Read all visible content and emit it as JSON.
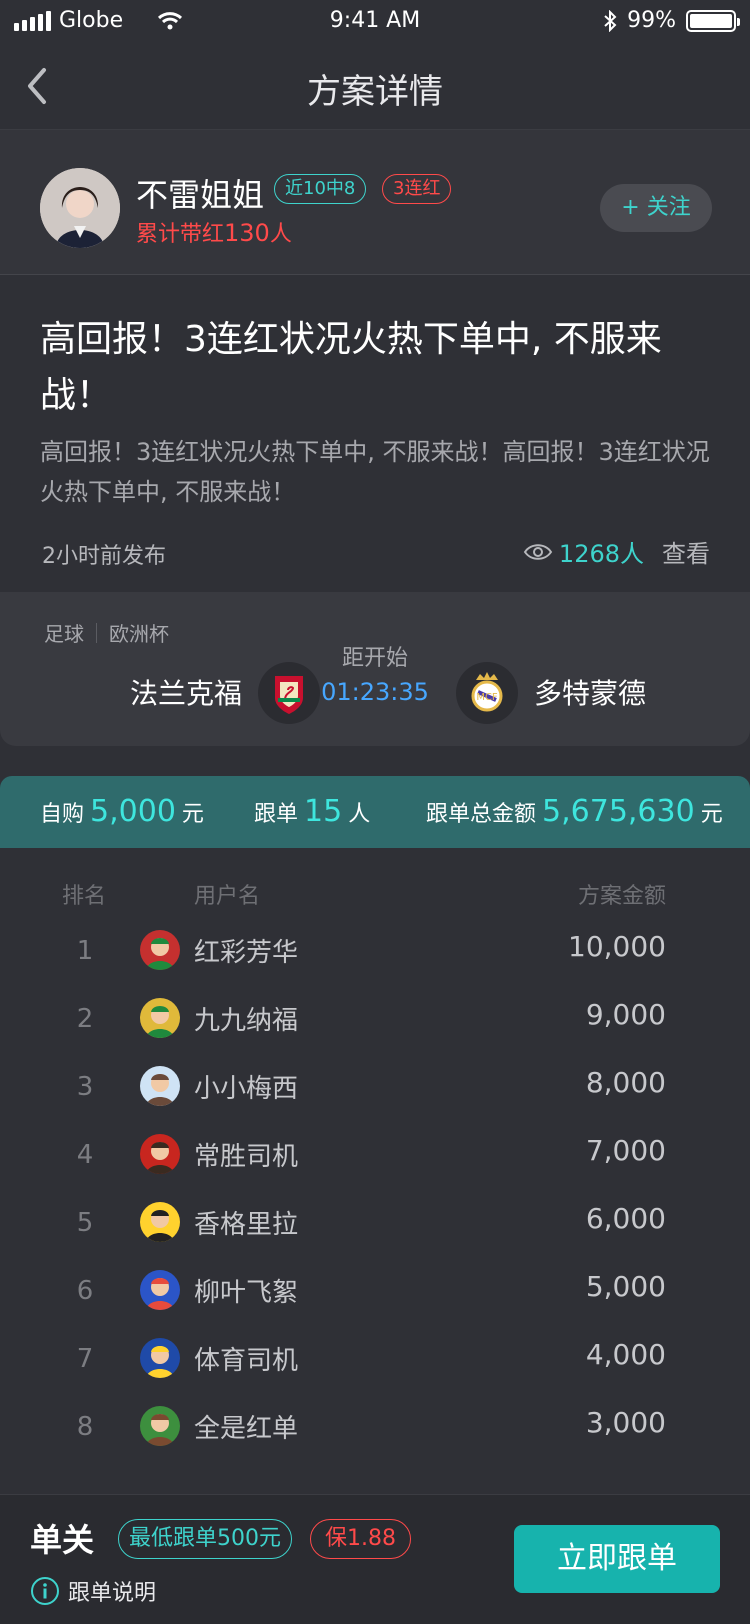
{
  "status_bar": {
    "carrier": "Globe",
    "time": "9:41 AM",
    "battery": "99%",
    "battery_level": 0.99
  },
  "nav": {
    "title": "方案详情"
  },
  "profile": {
    "name": "不雷姐姐",
    "tag_recent": "近10中8",
    "tag_streak": "3连红",
    "accum_prefix": "累计带红",
    "accum_count": "130",
    "accum_unit": "人",
    "follow_label": "+ 关注"
  },
  "article": {
    "title": "高回报！3连红状况火热下单中, 不服来战！",
    "summary": "高回报！3连红状况火热下单中, 不服来战！高回报！3连红状况火热下单中, 不服来战！",
    "posted": "2小时前发布",
    "views": "1268人",
    "views_label": "查看"
  },
  "match": {
    "sport": "足球",
    "league": "欧洲杯",
    "countdown_label": "距开始",
    "countdown": "01:23:35",
    "home": "法兰克福",
    "away": "多特蒙德"
  },
  "summary_bar": {
    "self_label": "自购",
    "self_value": "5,000",
    "self_unit": "元",
    "follow_label": "跟单",
    "follow_value": "15",
    "follow_unit": "人",
    "total_label": "跟单总金额",
    "total_value": "5,675,630",
    "total_unit": "元"
  },
  "table": {
    "headers": {
      "rank": "排名",
      "user": "用户名",
      "amount": "方案金额"
    },
    "rows": [
      {
        "rank": "1",
        "name": "红彩芳华",
        "amount": "10,000"
      },
      {
        "rank": "2",
        "name": "九九纳福",
        "amount": "9,000"
      },
      {
        "rank": "3",
        "name": "小小梅西",
        "amount": "8,000"
      },
      {
        "rank": "4",
        "name": "常胜司机",
        "amount": "7,000"
      },
      {
        "rank": "5",
        "name": "香格里拉",
        "amount": "6,000"
      },
      {
        "rank": "6",
        "name": "柳叶飞絮",
        "amount": "5,000"
      },
      {
        "rank": "7",
        "name": "体育司机",
        "amount": "4,000"
      },
      {
        "rank": "8",
        "name": "全是红单",
        "amount": "3,000"
      }
    ]
  },
  "bottom": {
    "type": "单关",
    "min_bet": "最低跟单500元",
    "odds": "保1.88",
    "explain": "跟单说明",
    "cta": "立即跟单"
  },
  "colors": {
    "accent": "#3ed3cc",
    "red": "#ff4a4a",
    "cta": "#17b3ad",
    "bar": "#2f6b6c"
  }
}
